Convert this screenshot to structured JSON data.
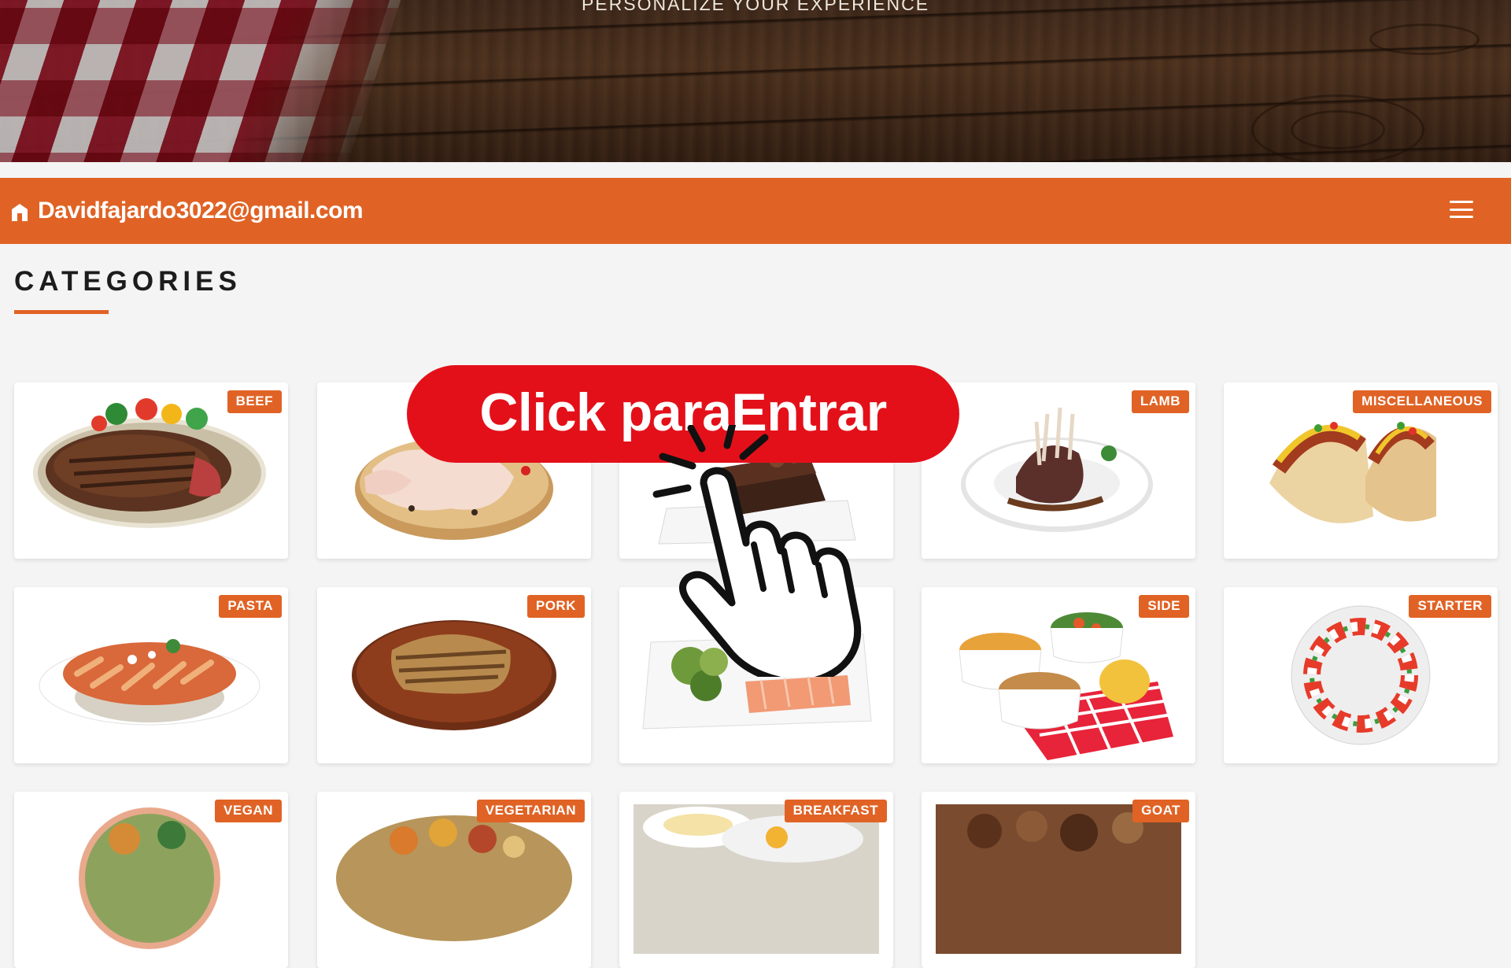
{
  "hero": {
    "tagline": "PERSONALIZE YOUR EXPERIENCE"
  },
  "navbar": {
    "home_icon": "home-icon",
    "user_email": "Davidfajardo3022@gmail.com",
    "menu_icon": "hamburger-menu-icon",
    "accent_color": "#e06325"
  },
  "section": {
    "title": "CATEGORIES"
  },
  "categories": [
    {
      "label": "BEEF",
      "image": "steak-plate"
    },
    {
      "label": "",
      "image": "raw-chicken"
    },
    {
      "label": "",
      "image": "chocolate-cake"
    },
    {
      "label": "LAMB",
      "image": "lamb-chops"
    },
    {
      "label": "MISCELLANEOUS",
      "image": "tacos"
    },
    {
      "label": "PASTA",
      "image": "penne-pasta"
    },
    {
      "label": "PORK",
      "image": "pork-chop"
    },
    {
      "label": "",
      "image": "salmon-salad"
    },
    {
      "label": "SIDE",
      "image": "side-dishes"
    },
    {
      "label": "STARTER",
      "image": "caprese-salad"
    },
    {
      "label": "VEGAN",
      "image": "vegan-bowl"
    },
    {
      "label": "VEGETARIAN",
      "image": "vegetarian-thali"
    },
    {
      "label": "BREAKFAST",
      "image": "breakfast-plate"
    },
    {
      "label": "GOAT",
      "image": "goat-stew"
    }
  ],
  "overlay": {
    "cta_label": "Click paraEntrar",
    "cta_color": "#e3101a",
    "pointer_icon": "hand-pointer-click-icon"
  }
}
